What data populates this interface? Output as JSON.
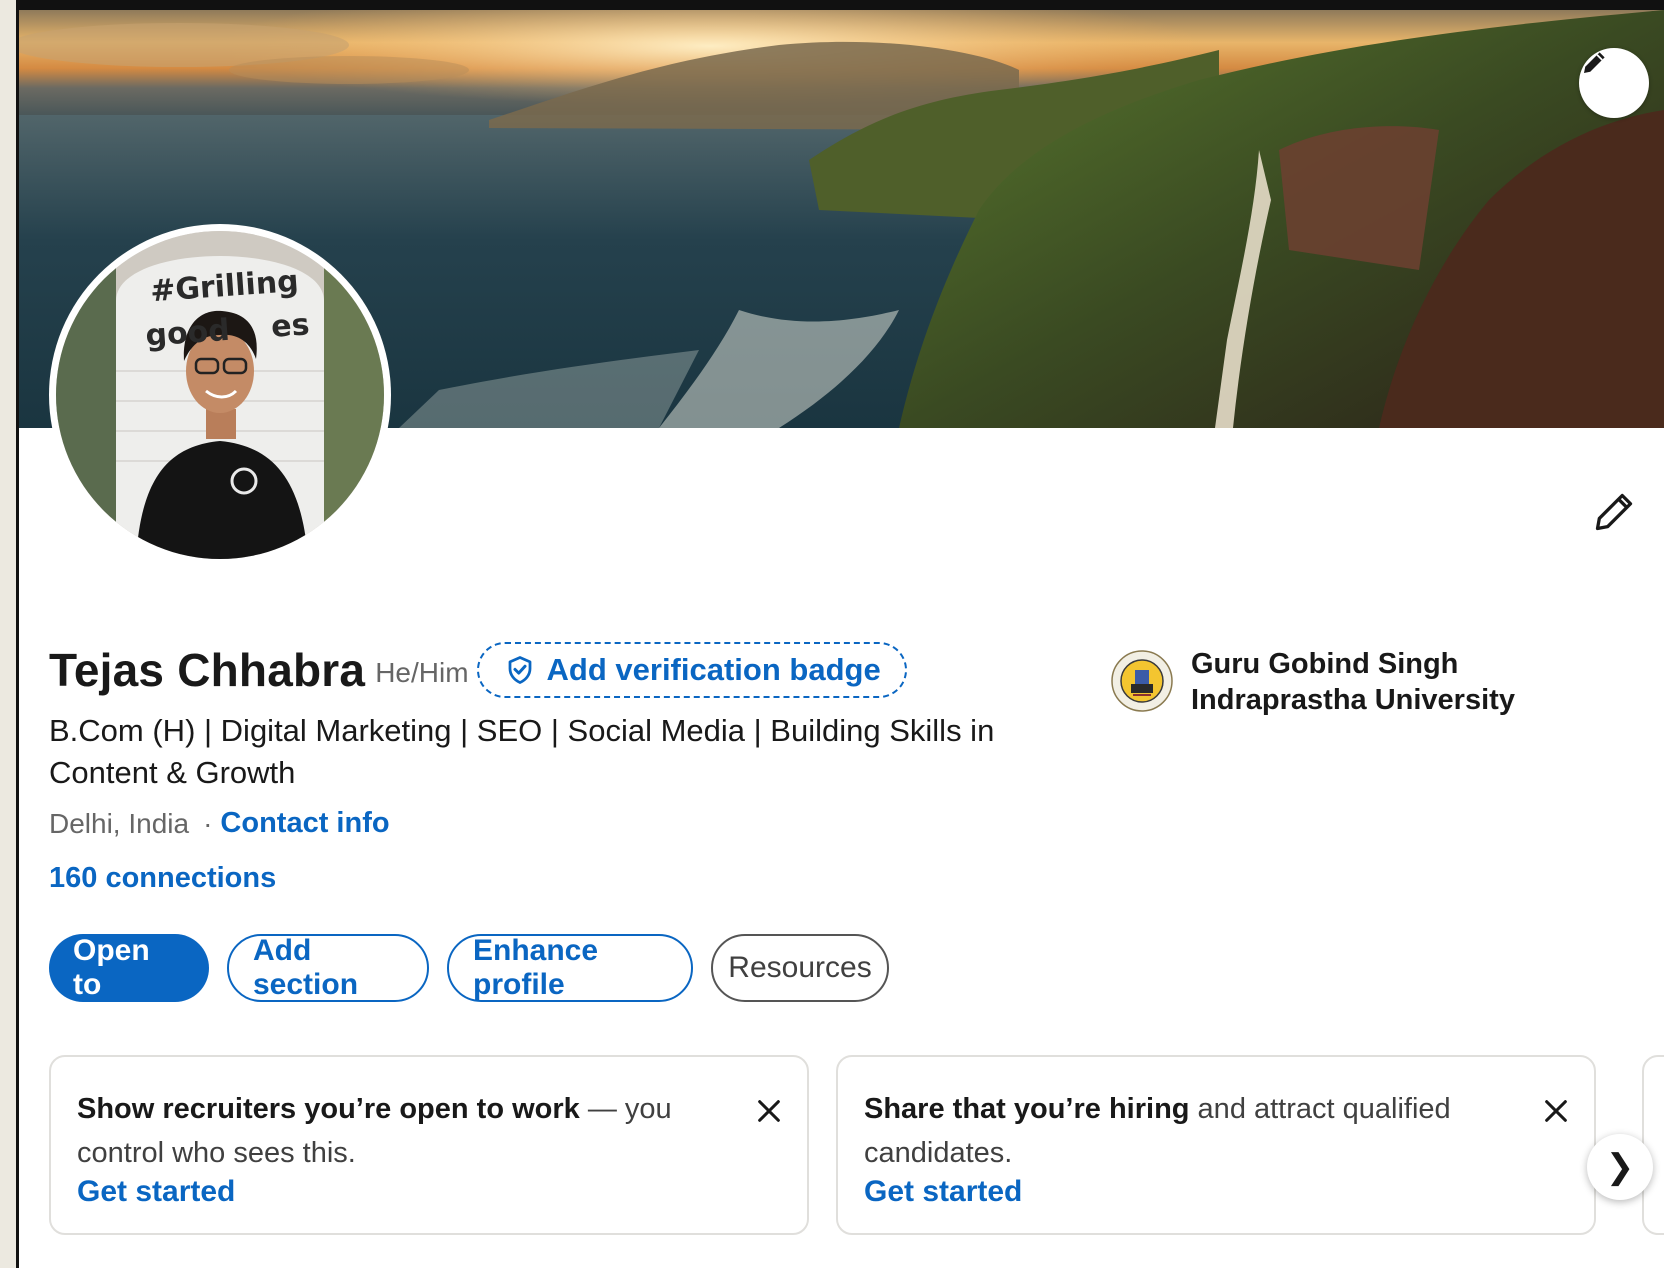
{
  "profile": {
    "name": "Tejas Chhabra",
    "pronouns": "He/Him",
    "verify_label": "Add verification badge",
    "headline": "B.Com (H) | Digital Marketing | SEO | Social Media | Building Skills in Content & Growth",
    "location": "Delhi, India",
    "separator": "·",
    "contact_label": "Contact info",
    "connections": "160 connections",
    "avatar_sign_line1": "#Grilling",
    "avatar_sign_line2": "good    es"
  },
  "education": {
    "school": "Guru Gobind Singh Indraprastha University"
  },
  "actions": {
    "open_to": "Open to",
    "add_section": "Add section",
    "enhance_profile": "Enhance profile",
    "resources": "Resources"
  },
  "suggestions": [
    {
      "bold": "Show recruiters you’re open to work",
      "rest": " — you control who sees this.",
      "link": "Get started"
    },
    {
      "bold": "Share that you’re hiring",
      "rest": " and attract qualified candidates.",
      "link": "Get started"
    }
  ],
  "icons": {
    "cover_edit": "pencil-icon",
    "intro_edit": "pencil-icon",
    "verify": "shield-check-icon",
    "dismiss": "close-icon",
    "next": "chevron-right-icon"
  },
  "colors": {
    "accent": "#0a66c2",
    "text": "#191919",
    "muted": "#666666"
  },
  "carousel_next": "❯"
}
